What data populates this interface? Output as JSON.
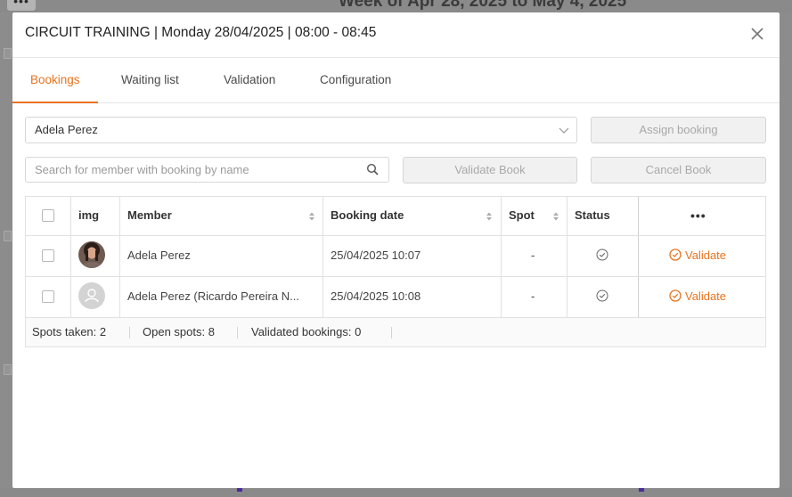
{
  "background": {
    "menu_icon": "more-dots-icon",
    "week_title": "Week of Apr 28, 2025 to May 4, 2025"
  },
  "modal": {
    "title": "CIRCUIT TRAINING | Monday 28/04/2025 | 08:00 - 08:45",
    "close_icon": "close-icon"
  },
  "tabs": [
    {
      "label": "Bookings",
      "active": true
    },
    {
      "label": "Waiting list",
      "active": false
    },
    {
      "label": "Validation",
      "active": false
    },
    {
      "label": "Configuration",
      "active": false
    }
  ],
  "member_select": {
    "value": "Adela Perez"
  },
  "assign_button": {
    "label": "Assign booking"
  },
  "search": {
    "placeholder": "Search for member with booking by name",
    "value": ""
  },
  "validate_book_button": {
    "label": "Validate Book"
  },
  "cancel_book_button": {
    "label": "Cancel Book"
  },
  "table": {
    "headers": {
      "img": "img",
      "member": "Member",
      "booking_date": "Booking date",
      "spot": "Spot",
      "status": "Status",
      "actions": "•••"
    },
    "rows": [
      {
        "member": "Adela Perez",
        "booking_date": "25/04/2025 10:07",
        "spot": "-",
        "action": "Validate",
        "avatar": "photo"
      },
      {
        "member": "Adela Perez (Ricardo Pereira N...",
        "booking_date": "25/04/2025 10:08",
        "spot": "-",
        "action": "Validate",
        "avatar": "placeholder"
      }
    ]
  },
  "footer": {
    "spots_taken": "Spots taken: 2",
    "open_spots": "Open spots: 8",
    "validated": "Validated bookings: 0"
  },
  "colors": {
    "accent": "#e8731e"
  }
}
